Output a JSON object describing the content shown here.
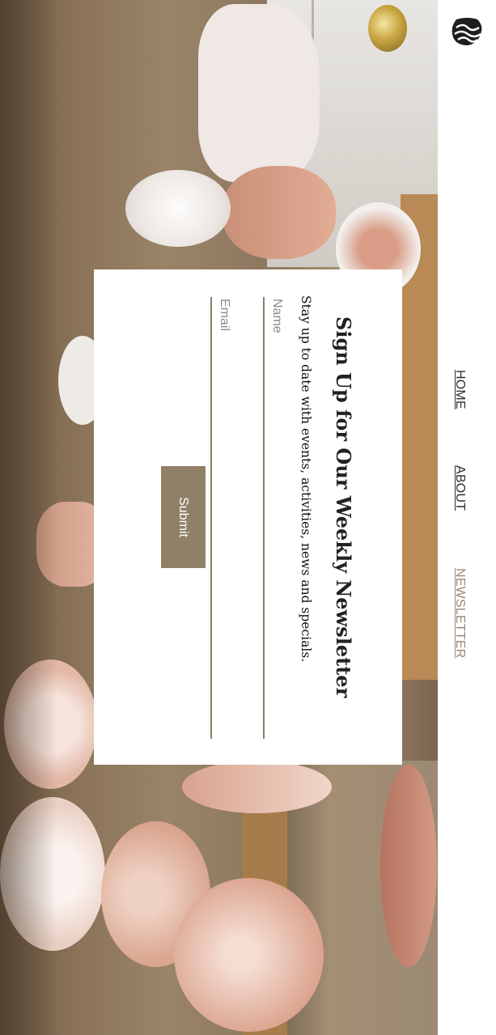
{
  "nav": {
    "items": [
      {
        "label": "HOME",
        "active": false
      },
      {
        "label": "ABOUT",
        "active": false
      },
      {
        "label": "NEWSLETTER",
        "active": true
      }
    ],
    "active_color": "#9b8670"
  },
  "newsletter": {
    "title": "Sign Up for Our Weekly Newsletter",
    "subtitle": "Stay up to date with events, activities, news and specials.",
    "name_placeholder": "Name",
    "email_placeholder": "Email",
    "submit_label": "Submit",
    "accent_color": "#918068"
  },
  "icons": {
    "logo": "wave-logo-icon"
  }
}
